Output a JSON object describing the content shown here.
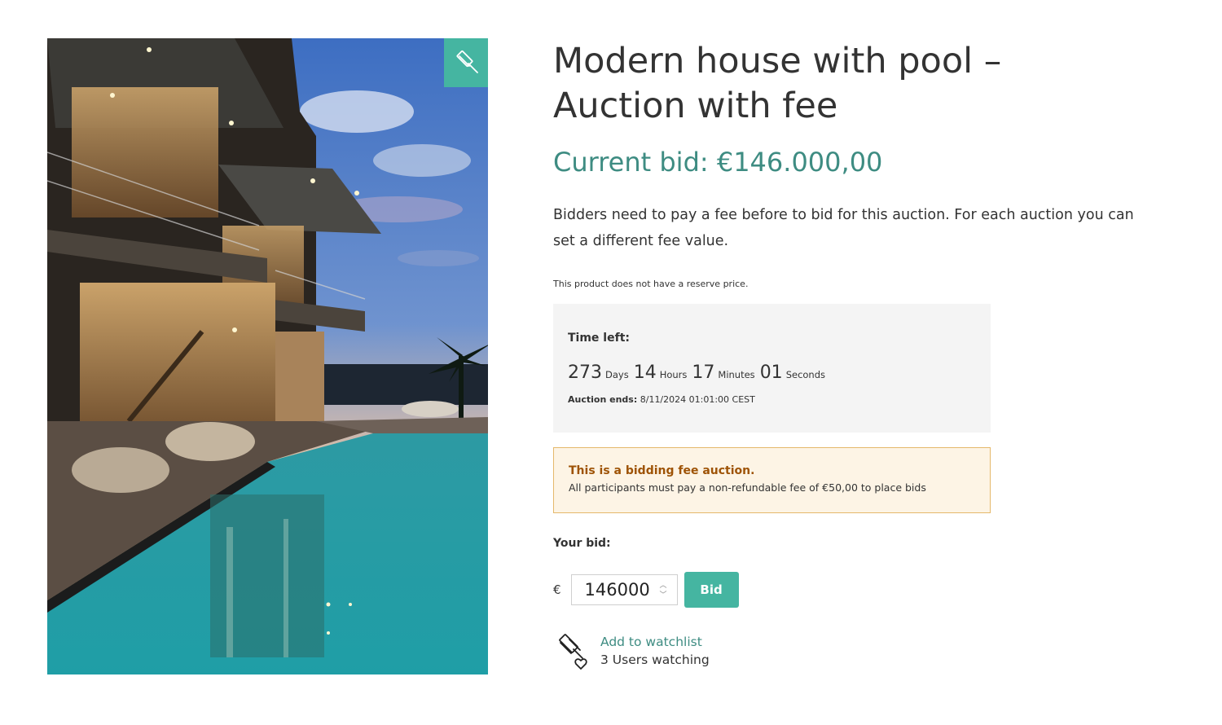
{
  "product": {
    "title_line1": "Modern house with pool –",
    "title_line2": "Auction with fee",
    "image_alt": "Modern house with pool at dusk"
  },
  "current_bid": {
    "label": "Current bid:",
    "amount": "€146.000,00"
  },
  "description": "Bidders need to pay a fee before to bid for this auction. For each auction you can set a different fee value.",
  "reserve_note": "This product does not have a reserve price.",
  "timer": {
    "label": "Time left:",
    "days": "273",
    "days_unit": "Days",
    "hours": "14",
    "hours_unit": "Hours",
    "minutes": "17",
    "minutes_unit": "Minutes",
    "seconds": "01",
    "seconds_unit": "Seconds",
    "ends_label": "Auction ends:",
    "ends_value": "8/11/2024 01:01:00 CEST"
  },
  "fee_notice": {
    "title": "This is a bidding fee auction.",
    "text": "All participants must pay a non-refundable fee of €50,00 to place bids"
  },
  "bid_form": {
    "label": "Your bid:",
    "currency": "€",
    "value": "146000",
    "button_label": "Bid"
  },
  "watchlist": {
    "link_label": "Add to watchlist",
    "count_text": "3 Users watching"
  },
  "colors": {
    "accent": "#45b5a1",
    "accent_text": "#3e8c82",
    "fee_title": "#9e5306",
    "fee_bg": "#fdf4e5",
    "fee_border": "#e5b86b"
  },
  "icons": {
    "badge": "gavel-icon",
    "watch": "gavel-heart-icon"
  }
}
